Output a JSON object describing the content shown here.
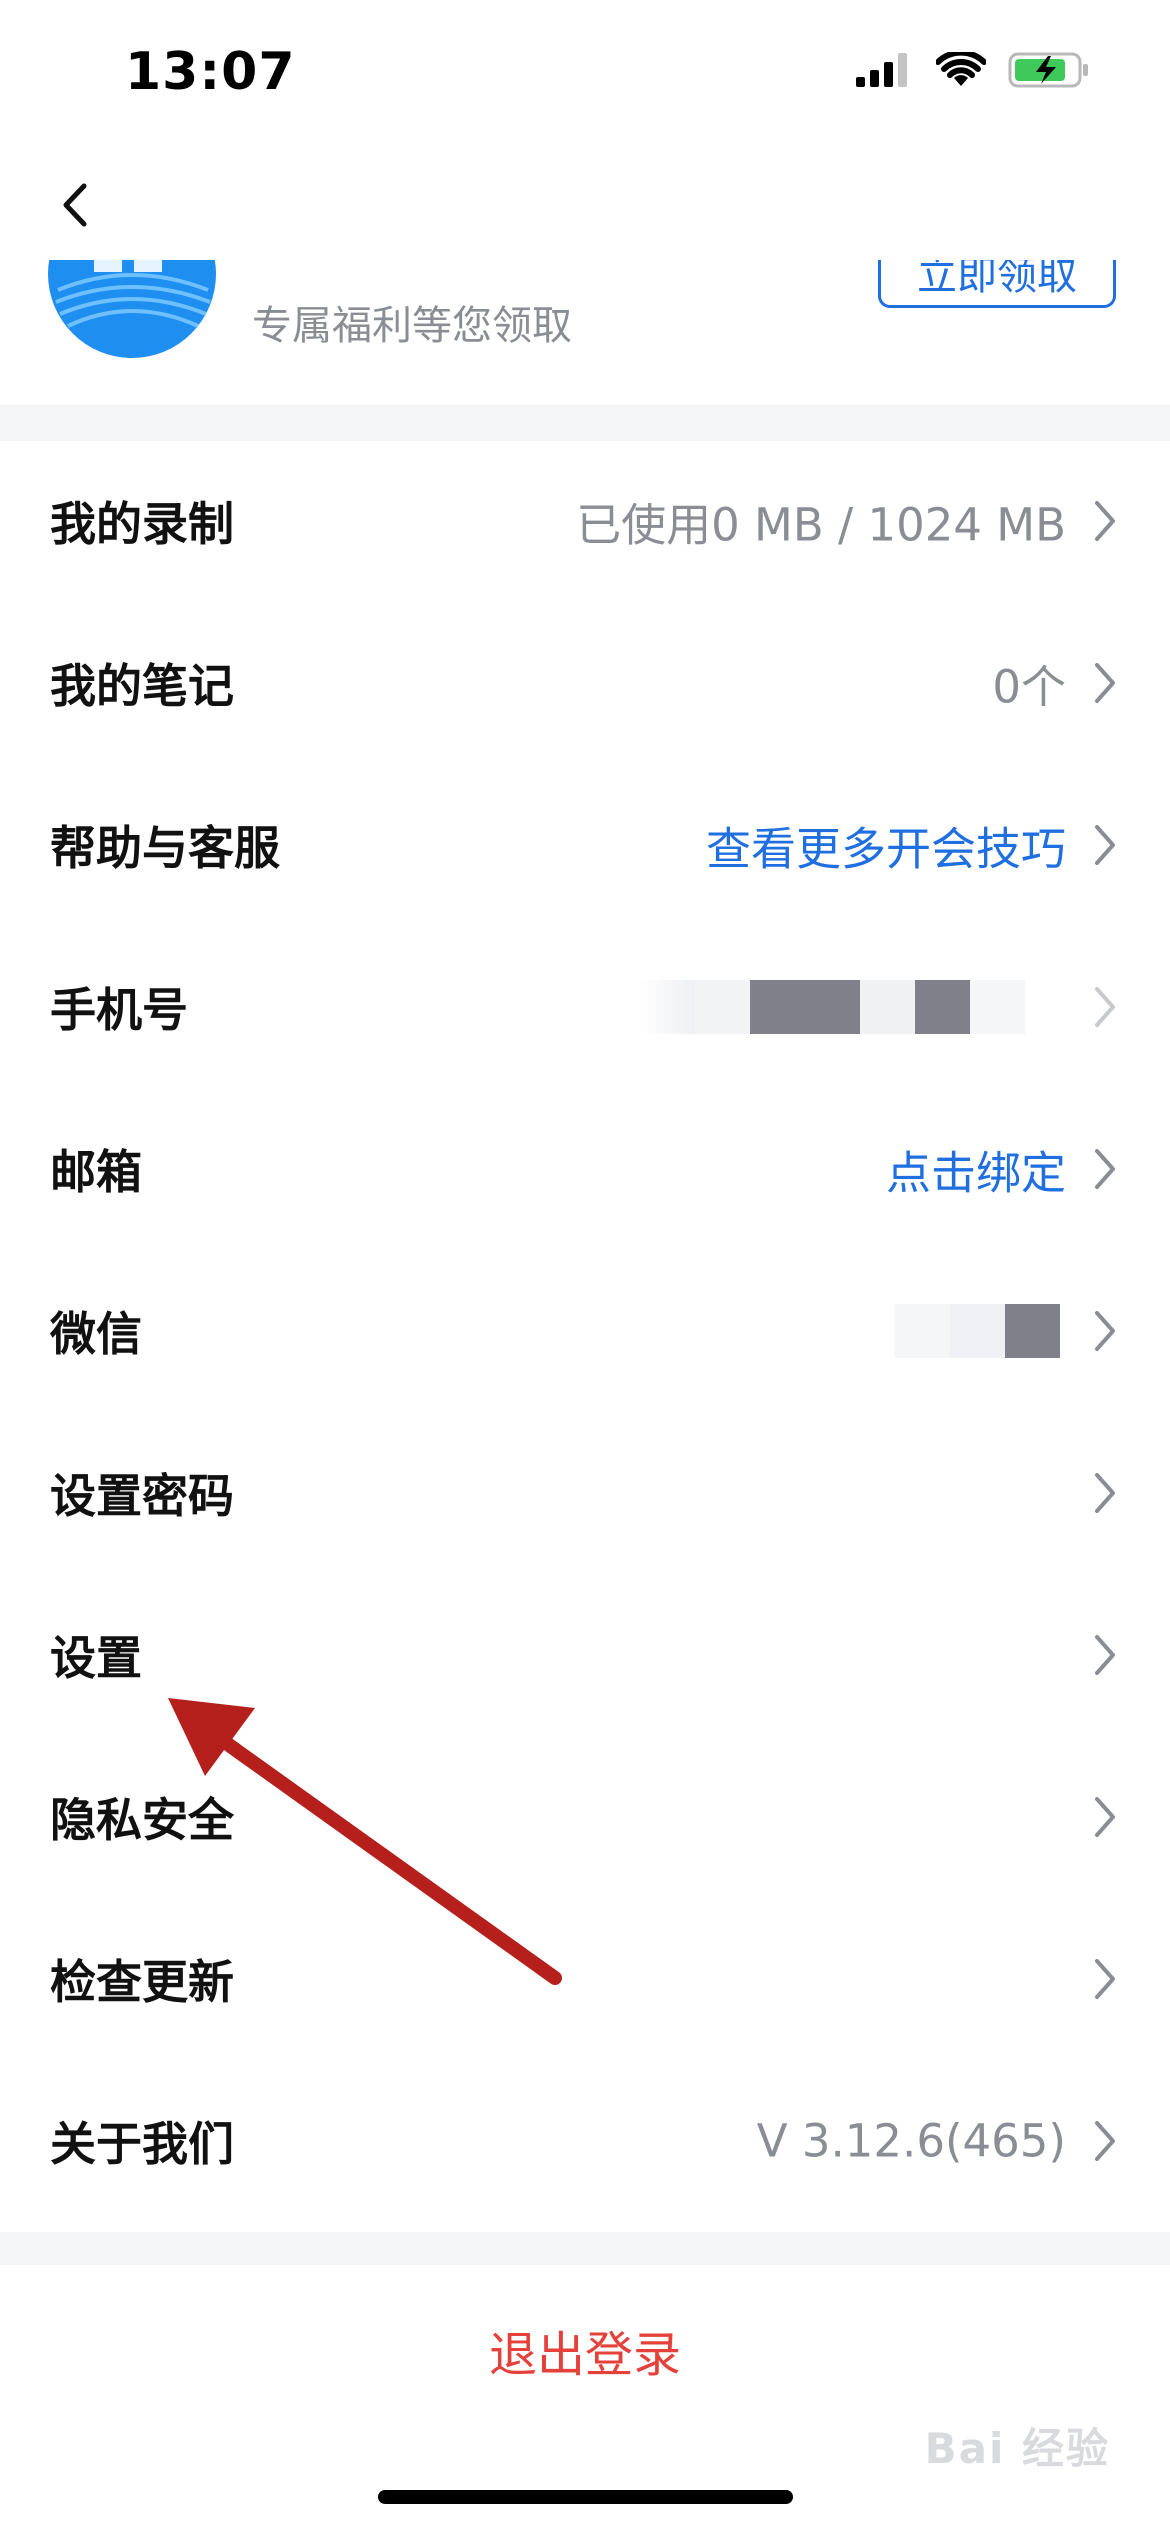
{
  "status_bar": {
    "time": "13:07"
  },
  "promo": {
    "subtitle": "专属福利等您领取",
    "button_label": "立即领取"
  },
  "menu": {
    "items": [
      {
        "label": "我的录制",
        "value": "已使用0 MB / 1024 MB",
        "value_style": "muted"
      },
      {
        "label": "我的笔记",
        "value": "0个",
        "value_style": "muted"
      },
      {
        "label": "帮助与客服",
        "value": "查看更多开会技巧",
        "value_style": "link"
      },
      {
        "label": "手机号",
        "value": "",
        "value_style": "redacted"
      },
      {
        "label": "邮箱",
        "value": "点击绑定",
        "value_style": "link"
      },
      {
        "label": "微信",
        "value": "",
        "value_style": "redacted"
      },
      {
        "label": "设置密码",
        "value": "",
        "value_style": "none"
      },
      {
        "label": "设置",
        "value": "",
        "value_style": "none"
      },
      {
        "label": "隐私安全",
        "value": "",
        "value_style": "none"
      },
      {
        "label": "检查更新",
        "value": "",
        "value_style": "none"
      },
      {
        "label": "关于我们",
        "value": "V 3.12.6(465)",
        "value_style": "muted"
      }
    ]
  },
  "logout": {
    "label": "退出登录"
  },
  "watermark": {
    "text": "Bai 经验"
  },
  "colors": {
    "accent": "#1f6fe0",
    "danger": "#e5403a",
    "muted": "#8a8d93",
    "annotation_arrow": "#b5201c"
  }
}
